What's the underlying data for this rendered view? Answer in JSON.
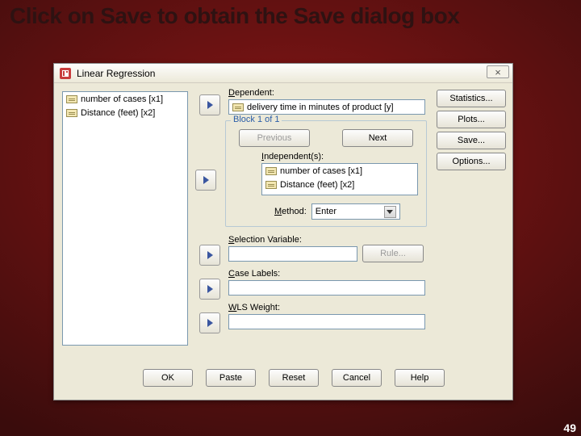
{
  "slide": {
    "title": "Click on Save to obtain the Save dialog box",
    "page_number": "49"
  },
  "dialog": {
    "title": "Linear Regression",
    "close_icon": "×",
    "source_vars": [
      "number of cases [x1]",
      "Distance (feet) [x2]"
    ],
    "dependent": {
      "label": "Dependent:",
      "value": "delivery time in minutes of product [y]"
    },
    "block": {
      "legend": "Block 1 of 1",
      "previous": "Previous",
      "next": "Next",
      "independents_label": "Independent(s):",
      "independents": [
        "number of cases [x1]",
        "Distance (feet) [x2]"
      ],
      "method_label": "Method:",
      "method_value": "Enter"
    },
    "selection": {
      "label": "Selection Variable:",
      "rule_btn": "Rule..."
    },
    "case_labels": {
      "label": "Case Labels:"
    },
    "wls": {
      "label": "WLS Weight:"
    },
    "side_buttons": {
      "statistics": "Statistics...",
      "plots": "Plots...",
      "save": "Save...",
      "options": "Options..."
    },
    "bottom_buttons": {
      "ok": "OK",
      "paste": "Paste",
      "reset": "Reset",
      "cancel": "Cancel",
      "help": "Help"
    }
  }
}
